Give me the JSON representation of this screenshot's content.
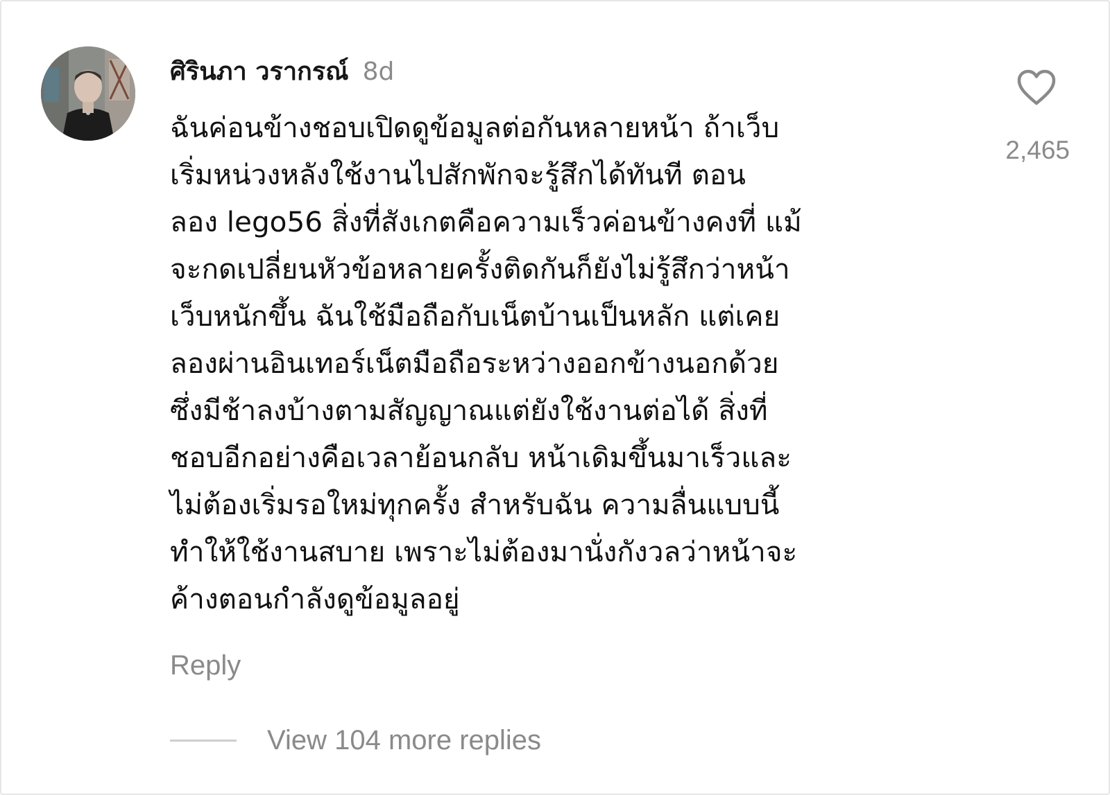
{
  "comment": {
    "author": "ศิรินภา วรากรณ์",
    "time": "8d",
    "text_lines": [
      "ฉันค่อนข้างชอบเปิดดูข้อมูลต่อกันหลายหน้า ถ้าเว็บ",
      "เริ่มหน่วงหลังใช้งานไปสักพักจะรู้สึกได้ทันที ตอน",
      "ลอง lego56 สิ่งที่สังเกตคือความเร็วค่อนข้างคงที่ แม้",
      "จะกดเปลี่ยนหัวข้อหลายครั้งติดกันก็ยังไม่รู้สึกว่าหน้า",
      "เว็บหนักขึ้น ฉันใช้มือถือกับเน็ตบ้านเป็นหลัก แต่เคย",
      "ลองผ่านอินเทอร์เน็ตมือถือระหว่างออกข้างนอกด้วย",
      "ซึ่งมีช้าลงบ้างตามสัญญาณแต่ยังใช้งานต่อได้ สิ่งที่",
      "ชอบอีกอย่างคือเวลาย้อนกลับ หน้าเดิมขึ้นมาเร็วและ",
      "ไม่ต้องเริ่มรอใหม่ทุกครั้ง สำหรับฉัน ความลื่นแบบนี้",
      "ทำให้ใช้งานสบาย เพราะไม่ต้องมานั่งกังวลว่าหน้าจะ",
      "ค้างตอนกำลังดูข้อมูลอยู่"
    ],
    "like_icon": "heart-outline-icon",
    "like_count": "2,465",
    "reply_label": "Reply",
    "view_replies_label": "View 104 more replies"
  },
  "colors": {
    "primary_text": "#111111",
    "secondary_text": "#8a8a8a",
    "divider": "#cfcfcf"
  }
}
